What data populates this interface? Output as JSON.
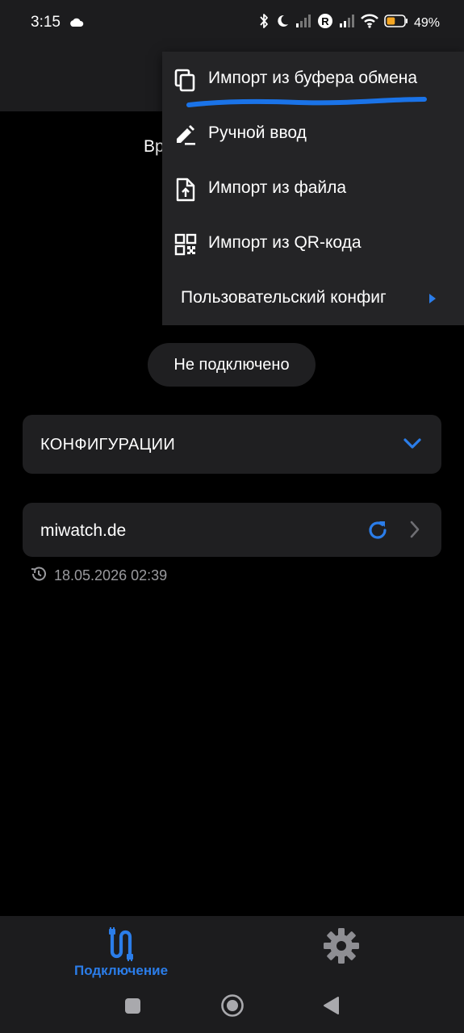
{
  "status_bar": {
    "time": "3:15",
    "battery_percent": "49%",
    "battery_level": 0.49,
    "battery_color": "#f5a623",
    "icons": [
      "cloud-icon",
      "bluetooth-icon",
      "moon-icon",
      "signal-icon",
      "roaming-r-icon",
      "signal-icon",
      "wifi-icon",
      "battery-icon"
    ]
  },
  "background_text": "Вр",
  "popup_menu": {
    "items": [
      {
        "label": "Импорт из буфера обмена",
        "icon": "clipboard-copy-icon"
      },
      {
        "label": "Ручной ввод",
        "icon": "pencil-icon"
      },
      {
        "label": "Импорт из файла",
        "icon": "file-upload-icon"
      },
      {
        "label": "Импорт из QR-кода",
        "icon": "qr-code-icon"
      },
      {
        "label": "Пользовательский конфиг",
        "icon": "chevron-right-icon"
      }
    ],
    "highlight_color": "#1a73e8"
  },
  "connection": {
    "status": "Не подключено"
  },
  "configs": {
    "title": "КОНФИГУРАЦИИ",
    "server": {
      "name": "miwatch.de",
      "updated": "18.05.2026 02:39"
    }
  },
  "bottom_nav": {
    "connect_label": "Подключение",
    "active_color": "#2b7de9"
  },
  "colors": {
    "accent": "#2b7de9",
    "surface": "#1f1f21",
    "menu": "#242426"
  }
}
